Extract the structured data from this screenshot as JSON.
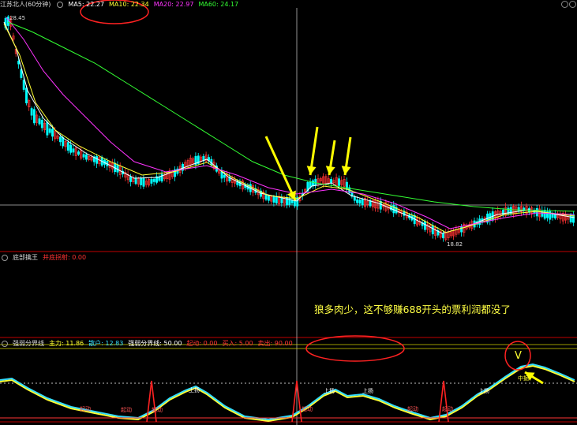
{
  "main": {
    "title": "江苏北人(60分钟)",
    "ma": [
      {
        "label": "MA5: 22.27",
        "color": "#ffffff"
      },
      {
        "label": "MA10: 22.34",
        "color": "#ffff33"
      },
      {
        "label": "MA20: 22.97",
        "color": "#ff33ff"
      },
      {
        "label": "MA60: 24.17",
        "color": "#33ff33"
      }
    ],
    "high_label": "28.45",
    "low_label": "18.82"
  },
  "sub1": {
    "title": "底部擒王",
    "items": [
      {
        "label": "并底拐射: 0.00",
        "color": "#ff3333"
      }
    ]
  },
  "sub2": {
    "title": "强弱分界线",
    "items": [
      {
        "label": "主力: 11.86",
        "color": "#ffff33"
      },
      {
        "label": "散户: 12.83",
        "color": "#33ddff"
      },
      {
        "label": "强弱分界线: 50.00",
        "color": "#ffffff"
      },
      {
        "label": "起动: 0.00",
        "color": "#ff3333"
      },
      {
        "label": "买入: 5.00",
        "color": "#ff3333"
      },
      {
        "label": "卖出: 90.00",
        "color": "#ff3333"
      }
    ],
    "tags_qidong": "起动",
    "tags_shangyang": "上扬",
    "tag_zhongjue": "中掘",
    "v_mark": "V"
  },
  "annotation": "狼多肉少，这不够赚688开头的票利润都没了",
  "colors": {
    "bg": "#000000",
    "up": "#ff3333",
    "down": "#00ffff",
    "ma5": "#ffffff",
    "ma10": "#ffff33",
    "ma20": "#ff33ff",
    "ma60": "#33ff33",
    "arrow": "#ffff00",
    "panel_border": "#c00000"
  }
}
